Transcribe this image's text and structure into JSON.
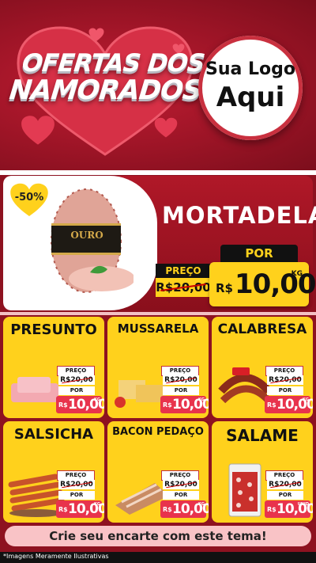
{
  "header": {
    "title_line1": "OFERTAS DOS",
    "title_line2": "NAMORADOS",
    "logo_line1": "Sua Logo",
    "logo_line2": "Aqui"
  },
  "featured": {
    "badge": "-50%",
    "name": "MORTADELA",
    "brand_label": "OURO",
    "preco_label": "PREÇO",
    "old_price": "R$20,00",
    "por_label": "POR",
    "currency": "R$",
    "new_price": "10,00",
    "unit": "KG"
  },
  "products": [
    {
      "name": "PRESUNTO",
      "preco_label": "PREÇO",
      "old_price": "R$20,00",
      "por_label": "POR",
      "currency": "R$",
      "new_price": "10,00",
      "unit": "KG"
    },
    {
      "name": "MUSSARELA",
      "preco_label": "PREÇO",
      "old_price": "R$20,00",
      "por_label": "POR",
      "currency": "R$",
      "new_price": "10,00",
      "unit": "KG"
    },
    {
      "name": "CALABRESA",
      "preco_label": "PREÇO",
      "old_price": "R$20,00",
      "por_label": "POR",
      "currency": "R$",
      "new_price": "10,00",
      "unit": "KG"
    },
    {
      "name": "SALSICHA",
      "preco_label": "PREÇO",
      "old_price": "R$20,00",
      "por_label": "POR",
      "currency": "R$",
      "new_price": "10,00",
      "unit": "KG"
    },
    {
      "name": "BACON PEDAÇO",
      "preco_label": "PREÇO",
      "old_price": "R$20,00",
      "por_label": "POR",
      "currency": "R$",
      "new_price": "10,00",
      "unit": "KG"
    },
    {
      "name": "SALAME",
      "preco_label": "PREÇO",
      "old_price": "R$20,00",
      "por_label": "POR",
      "currency": "R$",
      "new_price": "10,00",
      "unit": "UNID"
    }
  ],
  "cta": "Crie seu encarte com este tema!",
  "footer_note": "*Imagens Meramente Ilustrativas",
  "colors": {
    "background": "#8e1220",
    "card_yellow": "#ffd11c",
    "price_red": "#e8334c",
    "cta_pink": "#f9c3c6"
  }
}
